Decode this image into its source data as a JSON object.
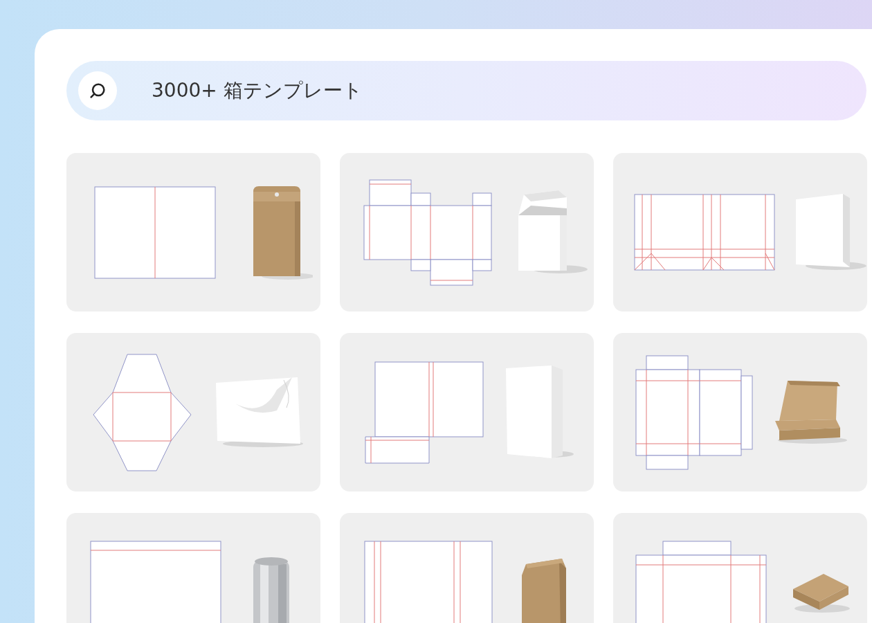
{
  "search": {
    "value": "3000+ 箱テンプレート"
  }
}
